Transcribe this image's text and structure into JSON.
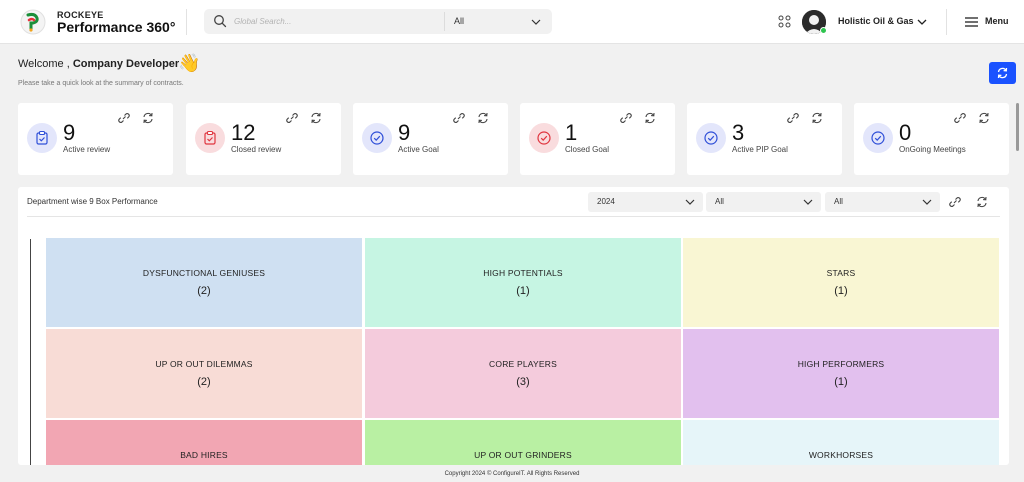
{
  "header": {
    "brand_top": "ROCKEYE",
    "brand_main": "Performance 360°",
    "search": {
      "placeholder": "Global Search...",
      "scope": "All"
    },
    "org_name": "Holistic Oil & Gas",
    "menu_label": "Menu"
  },
  "welcome": {
    "greeting": "Welcome ,",
    "user": "Company Developer",
    "emoji": "👋",
    "subtitle": "Please take a quick look at the summary of contracts."
  },
  "stats": [
    {
      "value": "9",
      "label": "Active review",
      "icon": "clipboard-check-icon",
      "tone": "blue"
    },
    {
      "value": "12",
      "label": "Closed review",
      "icon": "clipboard-check-icon",
      "tone": "red"
    },
    {
      "value": "9",
      "label": "Active Goal",
      "icon": "check-circle-icon",
      "tone": "blue"
    },
    {
      "value": "1",
      "label": "Closed Goal",
      "icon": "check-circle-icon",
      "tone": "red"
    },
    {
      "value": "3",
      "label": "Active PIP Goal",
      "icon": "check-circle-icon",
      "tone": "blue"
    },
    {
      "value": "0",
      "label": "OnGoing Meetings",
      "icon": "check-circle-icon",
      "tone": "blue"
    }
  ],
  "panel": {
    "title": "Department wise 9 Box Performance",
    "filters": [
      {
        "value": "2024"
      },
      {
        "value": "All"
      },
      {
        "value": "All"
      }
    ]
  },
  "nine_box": [
    {
      "title": "DYSFUNCTIONAL GENIUSES",
      "count": "(2)",
      "color": "#cfe0f2"
    },
    {
      "title": "HIGH POTENTIALS",
      "count": "(1)",
      "color": "#c6f5e3"
    },
    {
      "title": "STARS",
      "count": "(1)",
      "color": "#f9f6d3"
    },
    {
      "title": "UP OR OUT DILEMMAS",
      "count": "(2)",
      "color": "#f8dcd6"
    },
    {
      "title": "CORE PLAYERS",
      "count": "(3)",
      "color": "#f4cbdc"
    },
    {
      "title": "HIGH PERFORMERS",
      "count": "(1)",
      "color": "#e2c0ee"
    },
    {
      "title": "BAD HIRES",
      "count": "",
      "color": "#f2a6b3"
    },
    {
      "title": "UP OR OUT GRINDERS",
      "count": "",
      "color": "#b9f0a3"
    },
    {
      "title": "WORKHORSES",
      "count": "",
      "color": "#e6f5f9"
    }
  ],
  "colors": {
    "accent": "#1a52ff",
    "online": "#2ec44f"
  },
  "footer": "Copyright 2024 © ConfigureIT. All Rights Reserved"
}
